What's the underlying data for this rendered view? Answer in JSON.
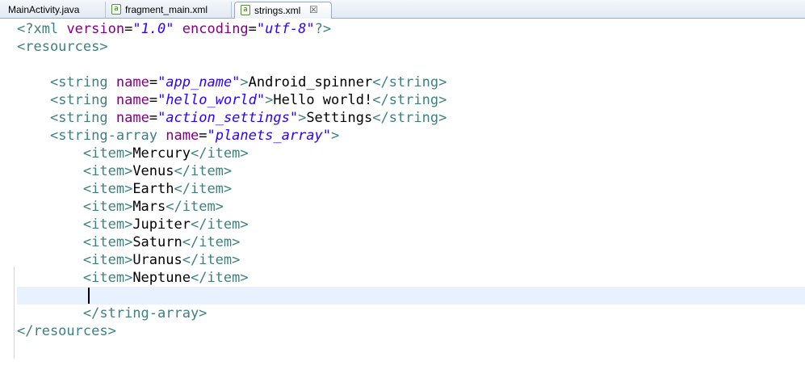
{
  "tabs": [
    {
      "label": "MainActivity.java",
      "active": false
    },
    {
      "label": "fragment_main.xml",
      "active": false,
      "icon": "android-xml-icon"
    },
    {
      "label": "strings.xml",
      "active": true,
      "icon": "android-xml-icon",
      "close": "☒"
    }
  ],
  "code": {
    "decl_open": "<?xml",
    "decl_version_attr": "version",
    "decl_version_val": "\"1.0\"",
    "decl_encoding_attr": "encoding",
    "decl_encoding_val": "\"utf-8\"",
    "decl_close": "?>",
    "resources_open": "<resources>",
    "strings": [
      {
        "name": "\"app_name\"",
        "value": "Android_spinner"
      },
      {
        "name": "\"hello_world\"",
        "value": "Hello world!"
      },
      {
        "name": "\"action_settings\"",
        "value": "Settings"
      }
    ],
    "string_open": "<string",
    "string_close": "</string>",
    "name_attr": "name",
    "array_open": "<string-array",
    "array_name": "\"planets_array\"",
    "item_open": "<item>",
    "item_close": "</item>",
    "items": [
      "Mercury",
      "Venus",
      "Earth",
      "Mars",
      "Jupiter",
      "Saturn",
      "Uranus",
      "Neptune"
    ],
    "array_close": "</string-array>",
    "resources_close": "</resources>"
  },
  "colors": {
    "tag": "#3f7f7f",
    "attribute": "#7f007f",
    "attribute_value": "#2a00ff",
    "current_line": "#e8f2fe"
  }
}
